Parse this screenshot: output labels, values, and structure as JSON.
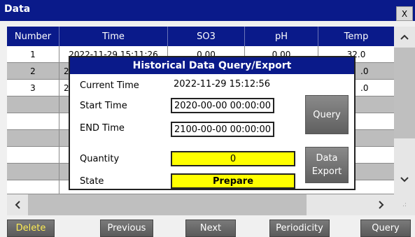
{
  "window": {
    "title": "Data",
    "close_label": "X"
  },
  "table": {
    "headers": [
      "Number",
      "Time",
      "SO3",
      "pH",
      "Temp"
    ],
    "rows": [
      [
        "1",
        "2022-11-29 15:11:26",
        "0.00",
        "0.00",
        "32.0"
      ],
      [
        "2",
        "2",
        "",
        "",
        ".0"
      ],
      [
        "3",
        "2",
        "",
        "",
        ".0"
      ]
    ]
  },
  "scroll": {
    "up": "^",
    "down": "v",
    "left": "<",
    "right": ">",
    "grip": ".:"
  },
  "buttons": {
    "delete": "Delete",
    "previous": "Previous",
    "next": "Next",
    "periodicity": "Periodicity",
    "query": "Query"
  },
  "dialog": {
    "title": "Historical Data Query/Export",
    "current_time_label": "Current Time",
    "current_time_value": "2022-11-29 15:12:56",
    "start_time_label": "Start Time",
    "start_time_value": "2020-00-00 00:00:00",
    "end_time_label": "END Time",
    "end_time_value": "2100-00-00 00:00:00",
    "quantity_label": "Quantity",
    "quantity_value": "0",
    "state_label": "State",
    "state_value": "Prepare",
    "query_button": "Query",
    "export_button_line1": "Data",
    "export_button_line2": "Export"
  }
}
